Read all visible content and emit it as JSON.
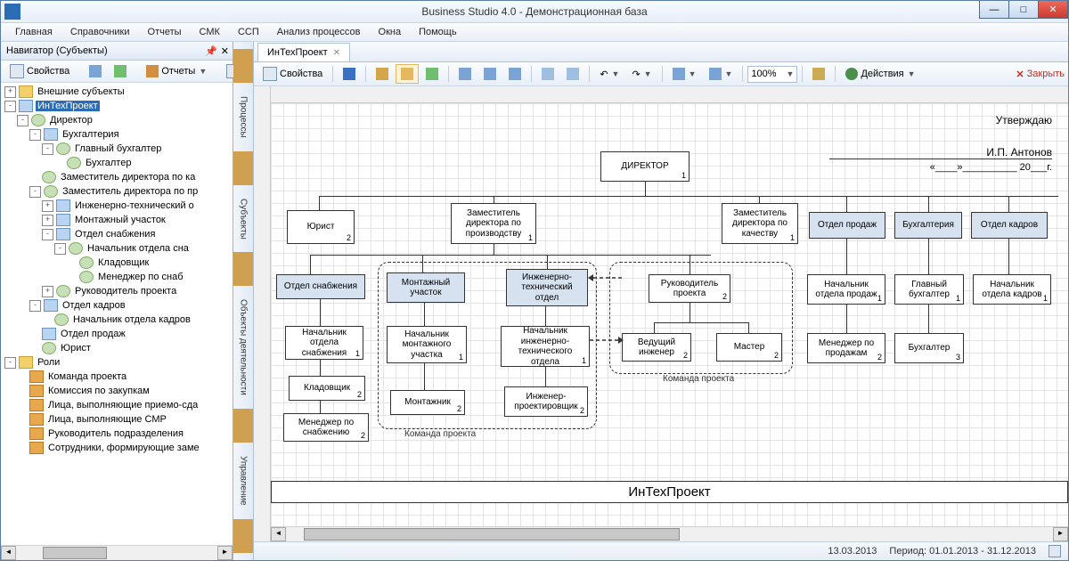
{
  "window": {
    "title": "Business Studio 4.0 - Демонстрационная база"
  },
  "menu": [
    "Главная",
    "Справочники",
    "Отчеты",
    "СМК",
    "ССП",
    "Анализ процессов",
    "Окна",
    "Помощь"
  ],
  "nav": {
    "title": "Навигатор (Субъекты)",
    "toolbar": {
      "props": "Свойства",
      "reports": "Отчеты"
    },
    "tree": [
      {
        "d": 0,
        "tw": "+",
        "ic": "folder",
        "t": "Внешние субъекты"
      },
      {
        "d": 0,
        "tw": "-",
        "ic": "org",
        "t": "ИнТехПроект",
        "sel": true
      },
      {
        "d": 1,
        "tw": "-",
        "ic": "person",
        "t": "Директор"
      },
      {
        "d": 2,
        "tw": "-",
        "ic": "org",
        "t": "Бухгалтерия"
      },
      {
        "d": 3,
        "tw": "-",
        "ic": "person",
        "t": "Главный бухгалтер"
      },
      {
        "d": 4,
        "tw": " ",
        "ic": "person",
        "t": "Бухгалтер"
      },
      {
        "d": 2,
        "tw": " ",
        "ic": "person",
        "t": "Заместитель директора по ка"
      },
      {
        "d": 2,
        "tw": "-",
        "ic": "person",
        "t": "Заместитель директора по пр"
      },
      {
        "d": 3,
        "tw": "+",
        "ic": "org",
        "t": "Инженерно-технический о"
      },
      {
        "d": 3,
        "tw": "+",
        "ic": "org",
        "t": "Монтажный участок"
      },
      {
        "d": 3,
        "tw": "-",
        "ic": "org",
        "t": "Отдел снабжения"
      },
      {
        "d": 4,
        "tw": "-",
        "ic": "person",
        "t": "Начальник отдела сна"
      },
      {
        "d": 5,
        "tw": " ",
        "ic": "person",
        "t": "Кладовщик"
      },
      {
        "d": 5,
        "tw": " ",
        "ic": "person",
        "t": "Менеджер по снаб"
      },
      {
        "d": 3,
        "tw": "+",
        "ic": "person",
        "t": "Руководитель проекта"
      },
      {
        "d": 2,
        "tw": "-",
        "ic": "org",
        "t": "Отдел кадров"
      },
      {
        "d": 3,
        "tw": " ",
        "ic": "person",
        "t": "Начальник отдела кадров"
      },
      {
        "d": 2,
        "tw": " ",
        "ic": "org",
        "t": "Отдел продаж"
      },
      {
        "d": 2,
        "tw": " ",
        "ic": "person",
        "t": "Юрист"
      },
      {
        "d": 0,
        "tw": "-",
        "ic": "folder",
        "t": "Роли"
      },
      {
        "d": 1,
        "tw": " ",
        "ic": "role",
        "t": "Команда проекта"
      },
      {
        "d": 1,
        "tw": " ",
        "ic": "role",
        "t": "Комиссия по закупкам"
      },
      {
        "d": 1,
        "tw": " ",
        "ic": "role",
        "t": "Лица, выполняющие приемо-сда"
      },
      {
        "d": 1,
        "tw": " ",
        "ic": "role",
        "t": "Лица, выполняющие СМР"
      },
      {
        "d": 1,
        "tw": " ",
        "ic": "role",
        "t": "Руководитель подразделения"
      },
      {
        "d": 1,
        "tw": " ",
        "ic": "role",
        "t": "Сотрудники, формирующие заме"
      }
    ]
  },
  "sidetabs": [
    "Процессы",
    "Субъекты",
    "Объекты деятельности",
    "Управление"
  ],
  "doc": {
    "tab": "ИнТехПроект",
    "toolbar": {
      "props": "Свойства",
      "zoom": "100%",
      "actions": "Действия",
      "close": "Закрыть"
    },
    "approve": {
      "t1": "Утверждаю",
      "t2": "И.П. Антонов",
      "t3": "«____»__________ 20___г."
    },
    "boxes": {
      "director": "ДИРЕКТОР",
      "jurist": "Юрист",
      "zam_prod": "Заместитель директора по производству",
      "zam_qual": "Заместитель директора по качеству",
      "sales": "Отдел продаж",
      "acc": "Бухгалтерия",
      "hr": "Отдел кадров",
      "supply": "Отдел снабжения",
      "mount": "Монтажный участок",
      "eng": "Инженерно-технический отдел",
      "pm": "Руководитель проекта",
      "sales_head": "Начальник отдела продаж",
      "acc_head": "Главный бухгалтер",
      "hr_head": "Начальник отдела кадров",
      "supply_head": "Начальник отдела снабжения",
      "mount_head": "Начальник монтажного участка",
      "eng_head": "Начальник инженерно-технического отдела",
      "lead_eng": "Ведущий инженер",
      "master": "Мастер",
      "sales_mgr": "Менеджер по продажам",
      "acc2": "Бухгалтер",
      "storeman": "Кладовщик",
      "mounter": "Монтажник",
      "designer": "Инженер-проектировщик",
      "supply_mgr": "Менеджер по снабжению"
    },
    "groups": {
      "team": "Команда проекта"
    },
    "footer": "ИнТехПроект"
  },
  "statusbar": {
    "date": "13.03.2013",
    "period": "Период: 01.01.2013 - 31.12.2013"
  }
}
